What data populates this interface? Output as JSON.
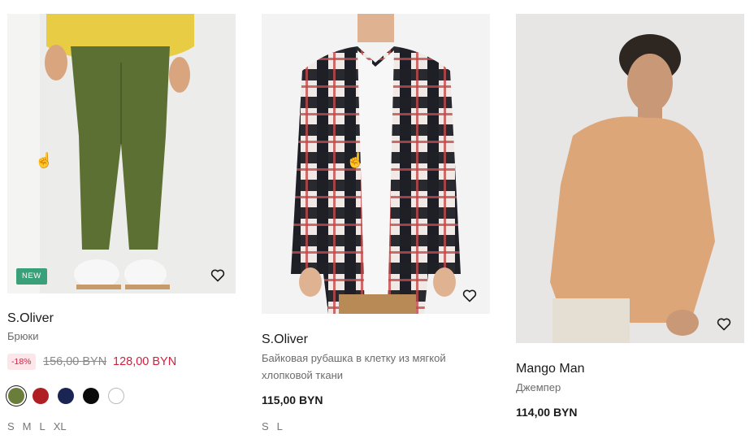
{
  "products": [
    {
      "badge": "NEW",
      "brand": "S.Oliver",
      "name": "Брюки",
      "discount": "-18%",
      "old_price": "156,00 BYN",
      "new_price": "128,00 BYN",
      "colors": [
        "#6b7d3a",
        "#b01f24",
        "#1b2554",
        "#0a0a0a",
        "#ffffff"
      ],
      "sizes": [
        "S",
        "M",
        "L",
        "XL"
      ]
    },
    {
      "brand": "S.Oliver",
      "name": "Байковая рубашка в клетку из мягкой хлопковой ткани",
      "price": "115,00 BYN",
      "sizes": [
        "S",
        "L"
      ]
    },
    {
      "brand": "Mango Man",
      "name": "Джемпер",
      "price": "114,00 BYN"
    }
  ],
  "icons": {
    "wishlist": "heart-outline-icon",
    "pointer": "hand-pointer-icon"
  }
}
